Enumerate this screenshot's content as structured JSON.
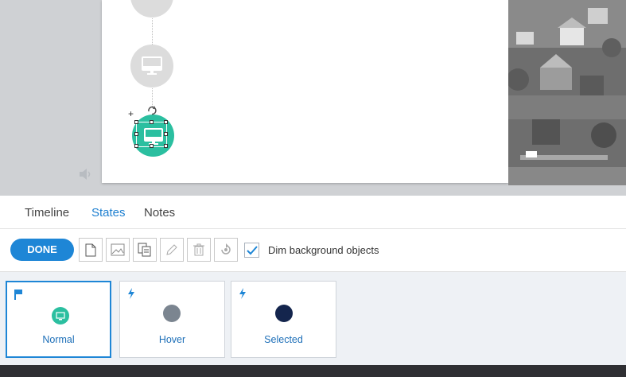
{
  "tabs": [
    {
      "label": "Timeline",
      "active": false
    },
    {
      "label": "States",
      "active": true
    },
    {
      "label": "Notes",
      "active": false
    }
  ],
  "toolbar": {
    "done_label": "DONE",
    "buttons": [
      "new-state-icon",
      "image-icon",
      "duplicate-icon",
      "edit-icon",
      "delete-icon",
      "reset-icon"
    ],
    "dim_background": {
      "label": "Dim background objects",
      "checked": true
    }
  },
  "states": [
    {
      "label": "Normal",
      "selected": true,
      "marker_icon": "flag-icon",
      "color": "#2bbfa0"
    },
    {
      "label": "Hover",
      "selected": false,
      "marker_icon": "lightning-icon",
      "color": "#7b8590"
    },
    {
      "label": "Selected",
      "selected": false,
      "marker_icon": "lightning-icon",
      "color": "#14254d"
    }
  ],
  "colors": {
    "accent": "#1e86d6",
    "teal": "#2bbfa0"
  }
}
